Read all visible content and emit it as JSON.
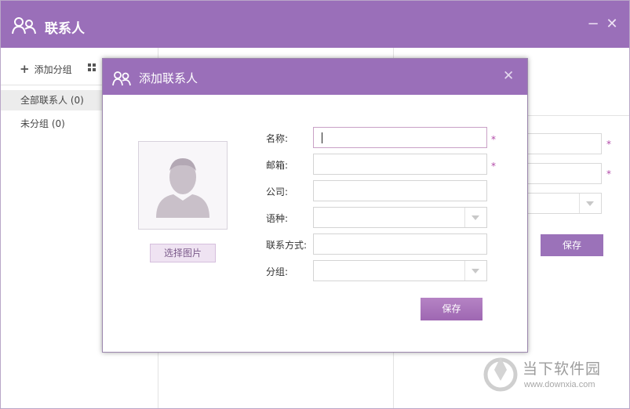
{
  "window": {
    "title": "联系人",
    "minimize": "−",
    "close": "✕"
  },
  "sidebar": {
    "add_group": "添加分组",
    "items": [
      {
        "label": "全部联系人 (0)"
      },
      {
        "label": "未分组 (0)"
      }
    ]
  },
  "background_form": {
    "save_label": "保存",
    "required_mark": "*"
  },
  "dialog": {
    "title": "添加联系人",
    "close": "✕",
    "pick_image": "选择图片",
    "fields": {
      "name": {
        "label": "名称:",
        "value": ""
      },
      "email": {
        "label": "邮箱:",
        "value": ""
      },
      "company": {
        "label": "公司:",
        "value": ""
      },
      "language": {
        "label": "语种:",
        "value": ""
      },
      "contact": {
        "label": "联系方式:",
        "value": ""
      },
      "group": {
        "label": "分组:",
        "value": ""
      }
    },
    "required_mark": "*",
    "save_label": "保存"
  },
  "watermark": {
    "title": "当下软件园",
    "url": "www.downxia.com"
  },
  "colors": {
    "accent": "#9a6fb9",
    "required": "#b24aa8"
  }
}
